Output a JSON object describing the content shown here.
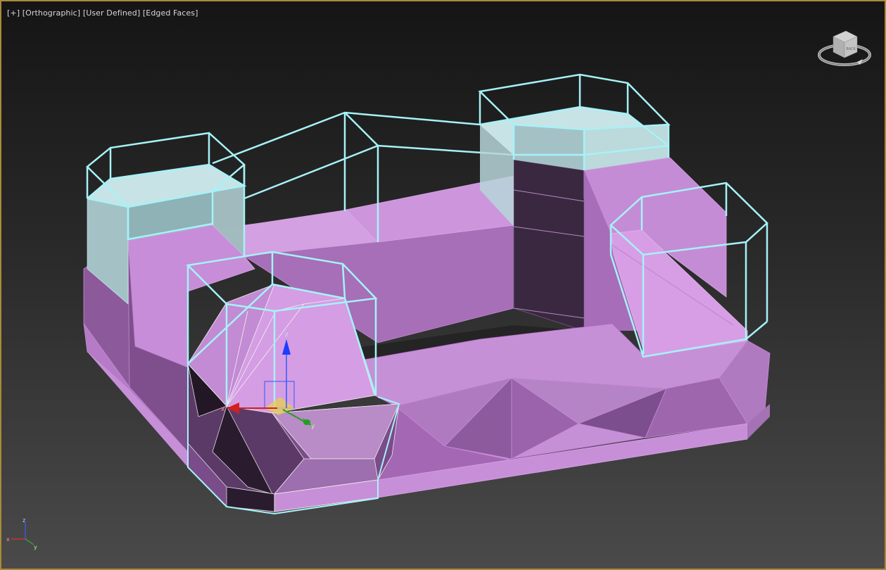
{
  "viewport": {
    "menu_plus": "[+]",
    "view_name": "[Orthographic]",
    "shading_light": "[User Defined]",
    "shading_mode": "[Edged Faces]"
  },
  "viewcube": {
    "face_label": "BACK",
    "icon": "viewcube-icon"
  },
  "gizmo": {
    "z_label": "z",
    "y_label": "y",
    "x_label": "x"
  },
  "world_axis": {
    "z_label": "z",
    "x_label": "x",
    "y_label": "y"
  },
  "colors": {
    "frame_border": "#a98a3a",
    "mesh_fill": "#d49be0",
    "mesh_dark": "#2a1c2e",
    "glass_fill": "#c7e3e6",
    "wire_cyan": "#a6f2f8",
    "axis_x": "#d02020",
    "axis_y": "#20a020",
    "axis_z": "#2040e0"
  }
}
